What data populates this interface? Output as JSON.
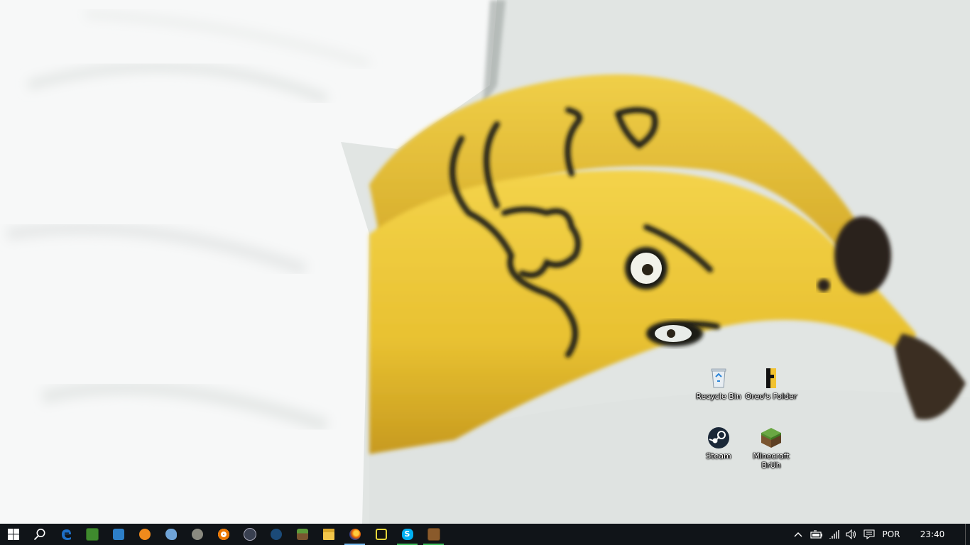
{
  "desktop": {
    "wallpaper": "bananas-in-bed",
    "icons": [
      {
        "label": "Recycle Bin",
        "icon": "recycle-bin-icon"
      },
      {
        "label": "Oreo's Folder",
        "icon": "folder-icon"
      },
      {
        "label": "Steam",
        "icon": "steam-icon"
      },
      {
        "label": "Minecraft BrUh",
        "icon": "minecraft-icon"
      }
    ]
  },
  "taskbar": {
    "color": "#101418",
    "pinned": [
      {
        "name": "start",
        "icon": "windows-logo-icon"
      },
      {
        "name": "search",
        "icon": "search-icon"
      },
      {
        "name": "edge",
        "icon": "edge-icon",
        "color": "#1e6fc7"
      },
      {
        "name": "app-green",
        "icon": "pixel-game-icon",
        "color": "#3f8a2e"
      },
      {
        "name": "app-blue",
        "icon": "control-panel-icon",
        "color": "#2d7fc8"
      },
      {
        "name": "app-orange",
        "icon": "audacity-icon",
        "color": "#f08a1c"
      },
      {
        "name": "paint",
        "icon": "paint-palette-icon",
        "color": "#6fa4d8"
      },
      {
        "name": "gimp",
        "icon": "gimp-icon",
        "color": "#8a8a80"
      },
      {
        "name": "blender",
        "icon": "blender-icon",
        "color": "#ea7600"
      },
      {
        "name": "obs",
        "icon": "obs-icon",
        "color": "#394050"
      },
      {
        "name": "steam",
        "icon": "steam-icon",
        "color": "#1b4a78"
      },
      {
        "name": "minecraft",
        "icon": "minecraft-grass-icon",
        "color": "#5c9a3a"
      },
      {
        "name": "file-explorer",
        "icon": "folder-icon",
        "color": "#f3c64a"
      },
      {
        "name": "firefox",
        "icon": "firefox-icon",
        "color": "#e66000"
      },
      {
        "name": "terminal-app",
        "icon": "terminal-icon",
        "color": "#e8d73a"
      },
      {
        "name": "skype",
        "icon": "skype-icon",
        "color": "#00aff0"
      },
      {
        "name": "minecraft-launcher",
        "icon": "crafting-table-icon",
        "color": "#8a5a2b"
      }
    ],
    "tray": {
      "chevron": "chevron-up-icon",
      "battery": "battery-icon",
      "network": "wifi-icon",
      "volume": "volume-icon",
      "notifications": "action-center-icon",
      "language": "POR",
      "time": "23:40"
    }
  }
}
